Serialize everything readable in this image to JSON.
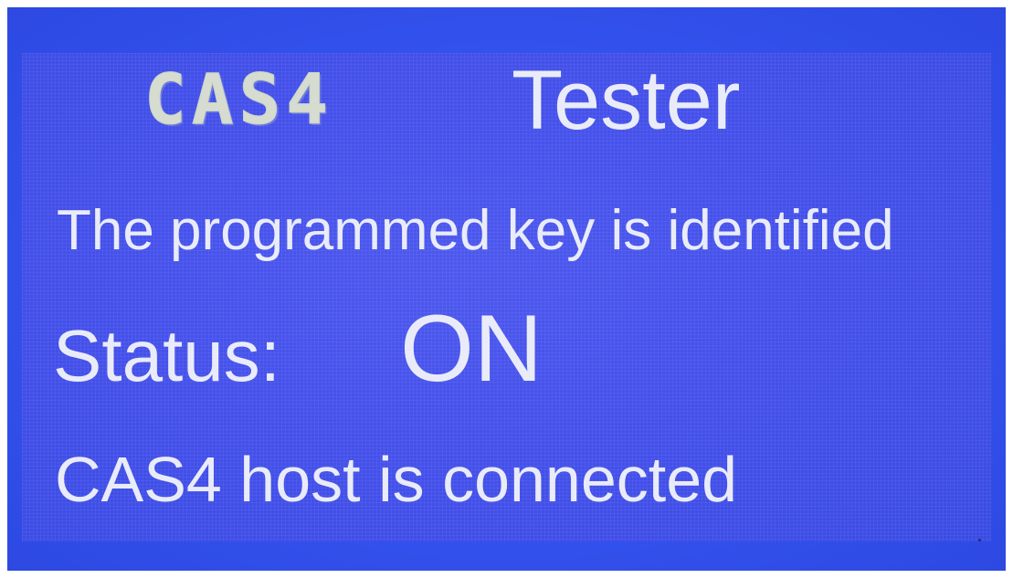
{
  "screen": {
    "brand": "CAS4",
    "title": "Tester",
    "message": "The programmed key is identified",
    "status": {
      "label": "Status:",
      "value": "ON"
    },
    "host_message": "CAS4 host is connected"
  },
  "colors": {
    "lcd_background": "#4450ea",
    "bezel_background": "#3452ee",
    "text": "#e9ecf8",
    "brand_text": "#d6dcd0"
  }
}
